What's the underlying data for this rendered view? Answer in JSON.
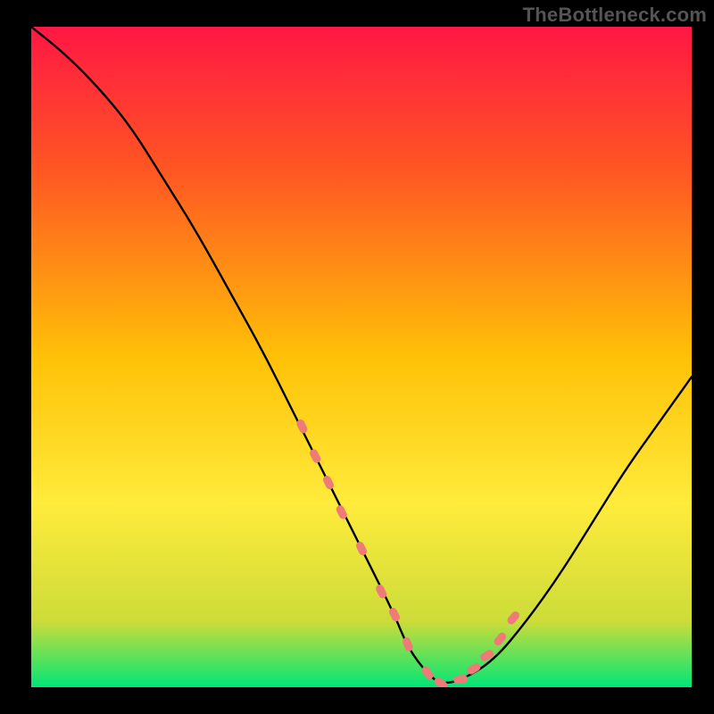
{
  "watermark": "TheBottleneck.com",
  "colors": {
    "bg": "#000000",
    "grad_top": "#ff1744",
    "grad_upper": "#ff5722",
    "grad_mid": "#ffc107",
    "grad_lower": "#ffeb3b",
    "grad_base": "#cddc39",
    "grad_bottom": "#00e676",
    "curve": "#000000",
    "marker": "#ef7b78"
  },
  "chart_data": {
    "type": "line",
    "title": "",
    "xlabel": "",
    "ylabel": "",
    "xlim": [
      0,
      100
    ],
    "ylim": [
      0,
      100
    ],
    "grid": false,
    "annotations": [
      "TheBottleneck.com"
    ],
    "series": [
      {
        "name": "bottleneck-curve",
        "x": [
          0,
          5,
          10,
          15,
          20,
          25,
          30,
          35,
          40,
          45,
          50,
          55,
          57,
          60,
          62,
          65,
          70,
          75,
          80,
          85,
          90,
          95,
          100
        ],
        "y": [
          100,
          96,
          91,
          85,
          77,
          69,
          60,
          51,
          41,
          31,
          21,
          11,
          6,
          2,
          0.5,
          1,
          4,
          10,
          17,
          25,
          33,
          40,
          47
        ]
      }
    ],
    "markers": {
      "name": "highlighted-points",
      "x": [
        41,
        43,
        45,
        47,
        50,
        53,
        55,
        57,
        60,
        62,
        65,
        67,
        69,
        71,
        73
      ],
      "y": [
        39.5,
        35,
        31,
        26.5,
        21,
        14.5,
        11,
        6.5,
        2.2,
        0.6,
        1.2,
        2.8,
        4.8,
        7.3,
        10.5
      ]
    }
  }
}
